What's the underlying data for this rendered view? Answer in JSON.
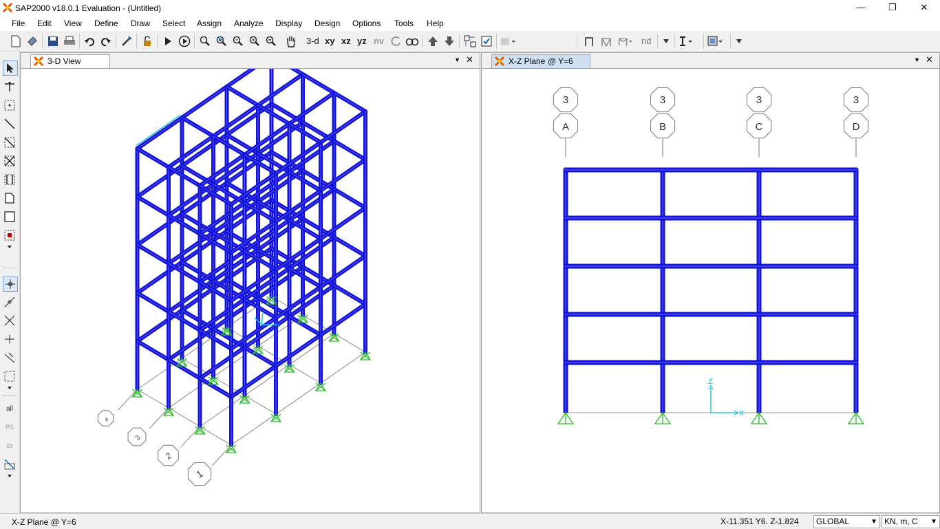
{
  "window": {
    "title": "SAP2000 v18.0.1 Evaluation  - (Untitled)",
    "minimize_glyph": "—",
    "restore_glyph": "❐",
    "close_glyph": "✕"
  },
  "menu": [
    "File",
    "Edit",
    "View",
    "Define",
    "Draw",
    "Select",
    "Assign",
    "Analyze",
    "Display",
    "Design",
    "Options",
    "Tools",
    "Help"
  ],
  "toolbar": {
    "view_3d": "3-d",
    "view_xy": "xy",
    "view_xz": "xz",
    "view_yz": "yz",
    "view_nv": "nv",
    "nd_label": "nd"
  },
  "lefttools": {
    "all": "all",
    "ps": "PS",
    "clr": "clr"
  },
  "left_pane": {
    "tab_label": "3-D View",
    "grid_bubbles": [
      "4",
      "3",
      "2",
      "1"
    ]
  },
  "right_pane": {
    "tab_label": "X-Z Plane @ Y=6",
    "grid_bubbles_top": [
      "3",
      "3",
      "3",
      "3"
    ],
    "grid_bubbles_bottom": [
      "A",
      "B",
      "C",
      "D"
    ],
    "axis_z": "Z",
    "axis_x": "X"
  },
  "pane_controls": {
    "dropdown": "▼",
    "close": "✕"
  },
  "status": {
    "view_name": "X-Z Plane @ Y=6",
    "coords": "X-11.351  Y6.  Z-1.824",
    "coord_system": "GLOBAL",
    "units": "KN, m, C"
  },
  "colors": {
    "frame": "#1414d8",
    "support": "#22c022",
    "axis": "#00c8e0",
    "accent": "#ff6a00"
  }
}
